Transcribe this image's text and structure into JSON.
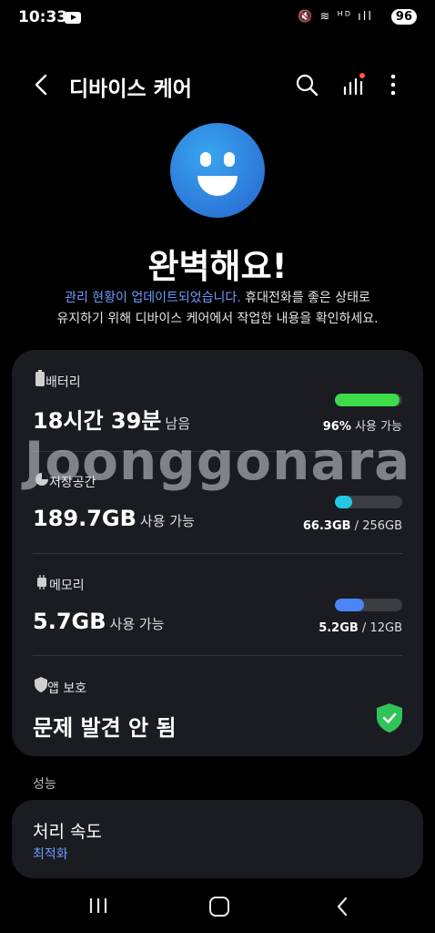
{
  "status_bar": {
    "time": "10:33",
    "icons": "🔇 ≋ ᴴᴰ ıll",
    "battery": "96"
  },
  "header": {
    "title": "디바이스 케어"
  },
  "hero": {
    "headline": "완벽해요!",
    "desc_link": "관리 현황이 업데이트되었습니다.",
    "desc_rest1": " 휴대전화를 좋은 상태로",
    "desc_rest2": "유지하기 위해 디바이스 케어에서 작업한 내용을 확인하세요."
  },
  "watermark": "Joonggonara",
  "battery": {
    "label": "배터리",
    "value": "18시간 39분",
    "suffix": "남음",
    "right_value": "96%",
    "right_suffix": "사용 가능",
    "fill": 0.96,
    "color": "#3ddc4b"
  },
  "storage": {
    "label": "저장공간",
    "value": "189.7GB",
    "suffix": "사용 가능",
    "used": "66.3GB",
    "total": "256GB",
    "fill": 0.26,
    "color": "#22c8e6"
  },
  "memory": {
    "label": "메모리",
    "value": "5.7GB",
    "suffix": "사용 가능",
    "used": "5.2GB",
    "total": "12GB",
    "fill": 0.43,
    "color": "#4a86f5"
  },
  "app_protection": {
    "label": "앱 보호",
    "value": "문제 발견 안 됨"
  },
  "performance": {
    "section": "성능",
    "title": "처리 속도",
    "status": "최적화"
  }
}
